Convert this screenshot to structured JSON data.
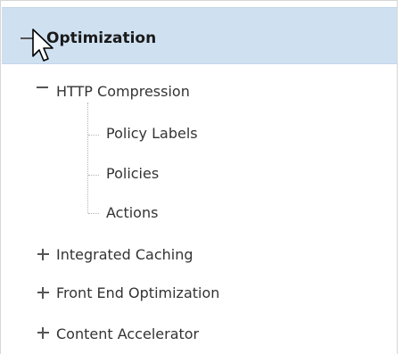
{
  "tree": {
    "root": {
      "label": "Optimization",
      "state": "expanded"
    },
    "items": [
      {
        "label": "HTTP Compression",
        "state": "expanded"
      },
      {
        "label": "Policy Labels"
      },
      {
        "label": "Policies"
      },
      {
        "label": "Actions"
      },
      {
        "label": "Integrated Caching",
        "state": "collapsed"
      },
      {
        "label": "Front End Optimization",
        "state": "collapsed"
      },
      {
        "label": "Content Accelerator",
        "state": "collapsed"
      }
    ]
  },
  "icons": {
    "expanded": "minus-icon",
    "collapsed": "plus-icon",
    "pointer": "mouse-pointer-icon"
  }
}
